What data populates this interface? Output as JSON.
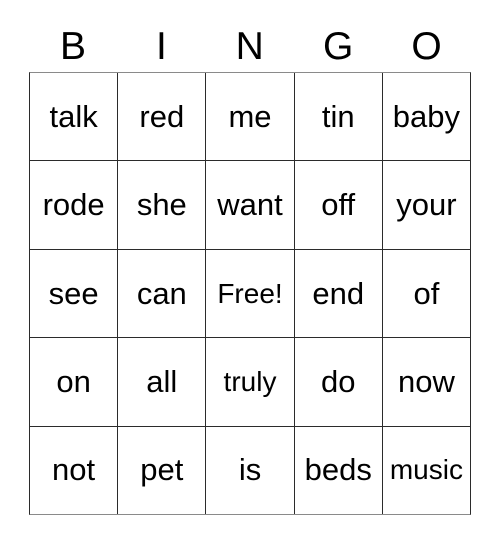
{
  "card": {
    "type": "bingo-card",
    "header": {
      "letters": [
        "B",
        "I",
        "N",
        "G",
        "O"
      ]
    },
    "grid": {
      "rows": 5,
      "columns": 5,
      "free_space": "Free!",
      "cells": [
        [
          {
            "text": "talk"
          },
          {
            "text": "red"
          },
          {
            "text": "me"
          },
          {
            "text": "tin"
          },
          {
            "text": "baby"
          }
        ],
        [
          {
            "text": "rode"
          },
          {
            "text": "she"
          },
          {
            "text": "want"
          },
          {
            "text": "off"
          },
          {
            "text": "your"
          }
        ],
        [
          {
            "text": "see"
          },
          {
            "text": "can"
          },
          {
            "text": "Free!"
          },
          {
            "text": "end"
          },
          {
            "text": "of"
          }
        ],
        [
          {
            "text": "on"
          },
          {
            "text": "all"
          },
          {
            "text": "truly"
          },
          {
            "text": "do"
          },
          {
            "text": "now"
          }
        ],
        [
          {
            "text": "not"
          },
          {
            "text": "pet"
          },
          {
            "text": "is"
          },
          {
            "text": "beds"
          },
          {
            "text": "music"
          }
        ]
      ]
    },
    "colors": {
      "text": "#000000",
      "background": "#ffffff",
      "grid_line": "#2b2b2b"
    }
  }
}
